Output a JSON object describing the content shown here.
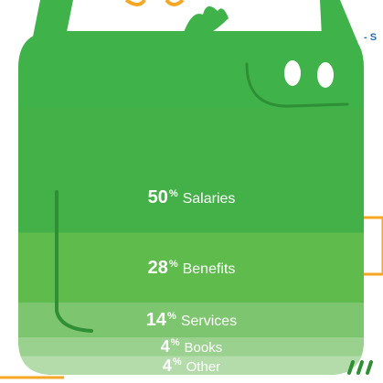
{
  "chart_data": {
    "type": "bar",
    "orientation": "stacked-100",
    "categories": [
      "Salaries",
      "Benefits",
      "Services",
      "Books",
      "Other"
    ],
    "values": [
      50,
      28,
      14,
      4,
      4
    ],
    "unit": "%",
    "colors": [
      "#43b048",
      "#5ebb4c",
      "#7dc56f",
      "#9bd18f",
      "#b3dcaa"
    ],
    "title": "",
    "xlabel": "",
    "ylabel": ""
  },
  "monster": {
    "body_color": "#3fb24a",
    "outline_color": "#2e8f35",
    "eye_color": "#ffffff",
    "accent_color": "#f5a623"
  },
  "side_text": "- S"
}
